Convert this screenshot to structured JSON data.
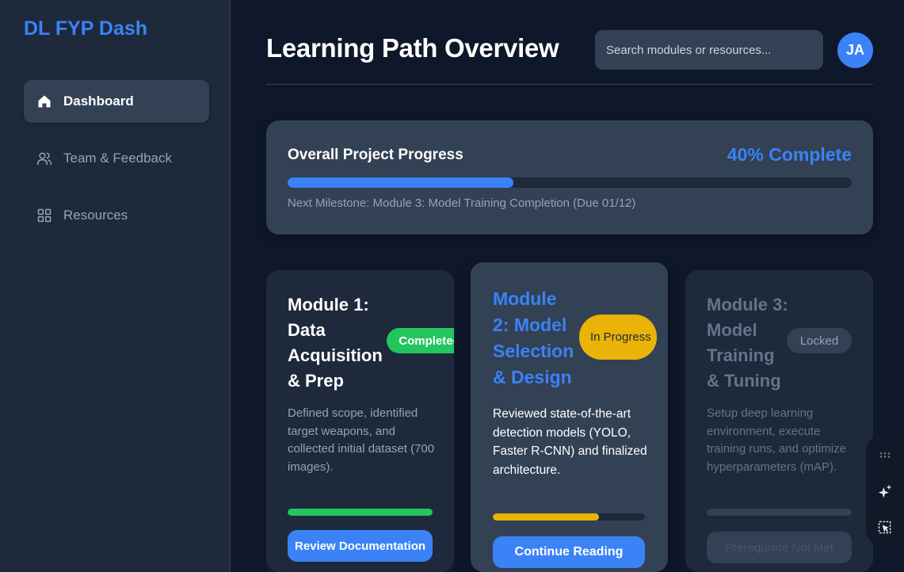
{
  "app": {
    "title": "DL FYP Dash"
  },
  "sidebar": {
    "items": [
      {
        "label": "Dashboard",
        "icon": "home-icon",
        "active": true
      },
      {
        "label": "Team & Feedback",
        "icon": "users-icon",
        "active": false
      },
      {
        "label": "Resources",
        "icon": "grid-icon",
        "active": false
      }
    ]
  },
  "header": {
    "title": "Learning Path Overview",
    "search_placeholder": "Search modules or resources...",
    "avatar_initials": "JA"
  },
  "progress": {
    "title": "Overall Project Progress",
    "percent_label": "40% Complete",
    "value": 0.4,
    "milestone": "Next Milestone: Module 3: Model Training Completion (Due 01/12)"
  },
  "modules": [
    {
      "title": "Module 1: Data Acquisition & Prep",
      "status": "Completed",
      "description": "Defined scope, identified target weapons, and collected initial dataset (700 images).",
      "progress": 1.0,
      "button": "Review Documentation"
    },
    {
      "title": "Module 2: Model Selection & Design",
      "status": "In Progress",
      "description": "Reviewed state-of-the-art detection models (YOLO, Faster R-CNN) and finalized architecture.",
      "progress": 0.7,
      "button": "Continue Reading"
    },
    {
      "title": "Module 3: Model Training & Tuning",
      "status": "Locked",
      "description": "Setup deep learning environment, execute training runs, and optimize hyperparameters (mAP).",
      "progress": 0,
      "button": "Prerequisite Not Met"
    }
  ],
  "colors": {
    "accent": "#3b82f6",
    "completed": "#22c55e",
    "in_progress": "#eab308",
    "locked": "#475569"
  },
  "floating_tools": [
    "grip-icon",
    "sparkle-icon",
    "select-icon"
  ]
}
